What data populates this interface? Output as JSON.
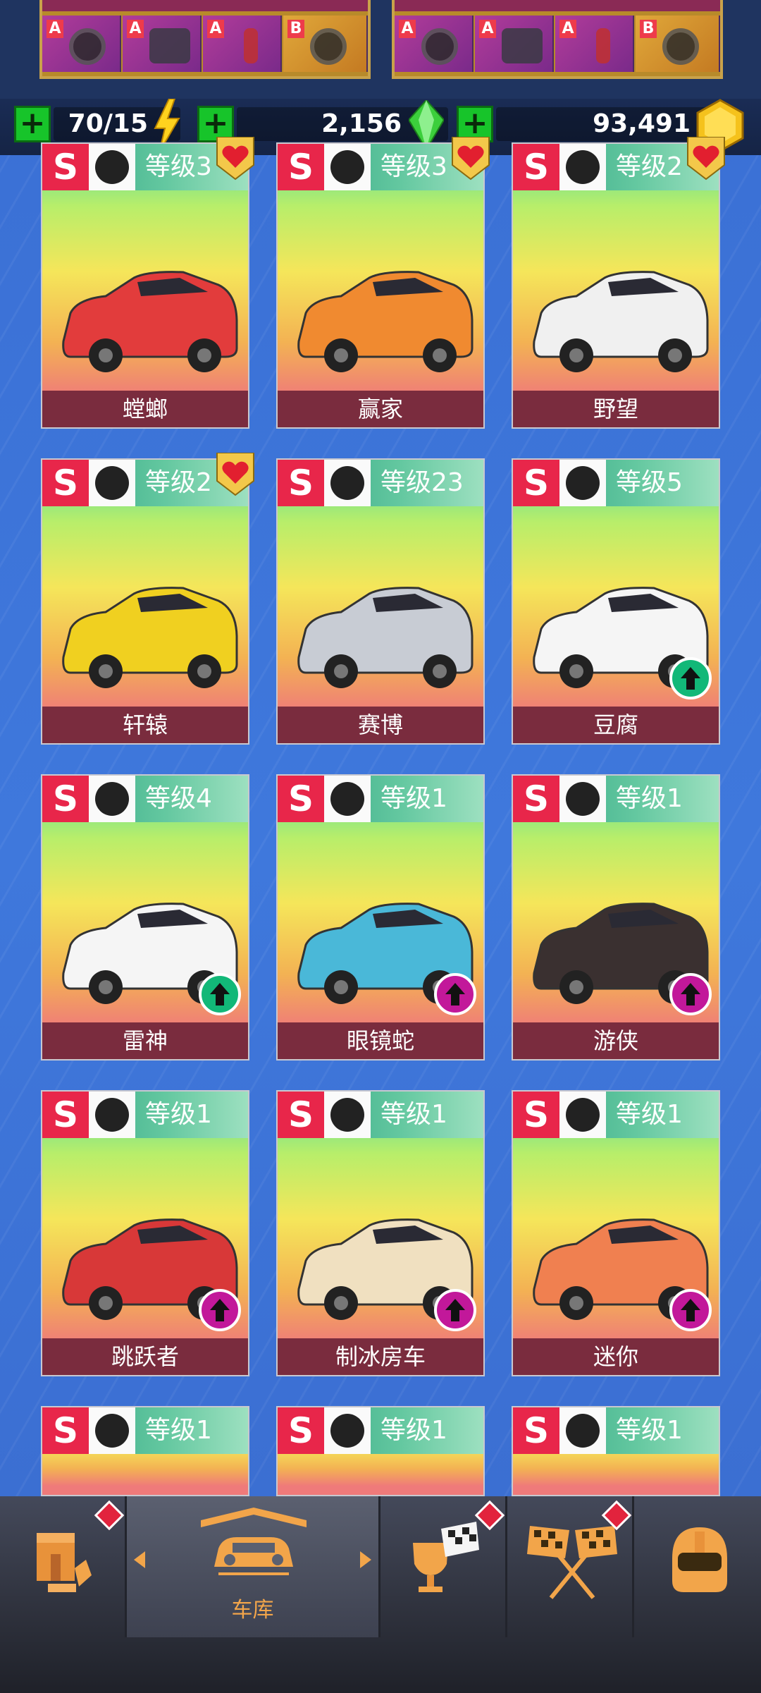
{
  "resources": {
    "energy": "70/15",
    "gems": "2,156",
    "coins": "93,491"
  },
  "parts_top": [
    {
      "grades": [
        "A",
        "A",
        "A",
        "B"
      ]
    },
    {
      "grades": [
        "A",
        "A",
        "A",
        "B"
      ]
    }
  ],
  "cars": [
    {
      "rank": "S",
      "class_icon": "road-icon",
      "level": "等级3",
      "name": "螳螂",
      "favorite": true,
      "upgrade": null
    },
    {
      "rank": "S",
      "class_icon": "horse-icon",
      "level": "等级3",
      "name": "赢家",
      "favorite": true,
      "upgrade": null
    },
    {
      "rank": "S",
      "class_icon": "wheel-icon",
      "level": "等级2",
      "name": "野望",
      "favorite": true,
      "upgrade": null
    },
    {
      "rank": "S",
      "class_icon": "crown-icon",
      "level": "等级2",
      "name": "轩辕",
      "favorite": true,
      "upgrade": null
    },
    {
      "rank": "S",
      "class_icon": "wheel-icon",
      "level": "等级23",
      "name": "赛博",
      "favorite": false,
      "upgrade": null
    },
    {
      "rank": "S",
      "class_icon": "road-icon",
      "level": "等级5",
      "name": "豆腐",
      "favorite": false,
      "upgrade": "green"
    },
    {
      "rank": "S",
      "class_icon": "crown-icon",
      "level": "等级4",
      "name": "雷神",
      "favorite": false,
      "upgrade": "green"
    },
    {
      "rank": "S",
      "class_icon": "road-icon",
      "level": "等级1",
      "name": "眼镜蛇",
      "favorite": false,
      "upgrade": "purple"
    },
    {
      "rank": "S",
      "class_icon": "horse-icon",
      "level": "等级1",
      "name": "游侠",
      "favorite": false,
      "upgrade": "purple"
    },
    {
      "rank": "S",
      "class_icon": "wheel-icon",
      "level": "等级1",
      "name": "跳跃者",
      "favorite": false,
      "upgrade": "purple"
    },
    {
      "rank": "S",
      "class_icon": "horse-icon",
      "level": "等级1",
      "name": "制冰房车",
      "favorite": false,
      "upgrade": "purple"
    },
    {
      "rank": "S",
      "class_icon": "road-icon",
      "level": "等级1",
      "name": "迷你",
      "favorite": false,
      "upgrade": "purple"
    },
    {
      "rank": "S",
      "class_icon": "wheel-icon",
      "level": "等级1",
      "name": "",
      "favorite": false,
      "upgrade": null
    },
    {
      "rank": "S",
      "class_icon": "road-icon",
      "level": "等级1",
      "name": "",
      "favorite": false,
      "upgrade": null
    },
    {
      "rank": "S",
      "class_icon": "horse-icon",
      "level": "等级1",
      "name": "",
      "favorite": false,
      "upgrade": null
    }
  ],
  "nav": {
    "garage_label": "车库",
    "items": [
      "shop-icon",
      "garage-icon",
      "trophy-icon",
      "race-flags-icon",
      "helmet-icon"
    ]
  },
  "colors": {
    "background": "#3d73d6",
    "rank_red": "#e8264a",
    "name_bar": "#7a2c3e",
    "upgrade_green": "#12b878",
    "upgrade_purple": "#c2189a",
    "nav_accent": "#f2a54a"
  }
}
